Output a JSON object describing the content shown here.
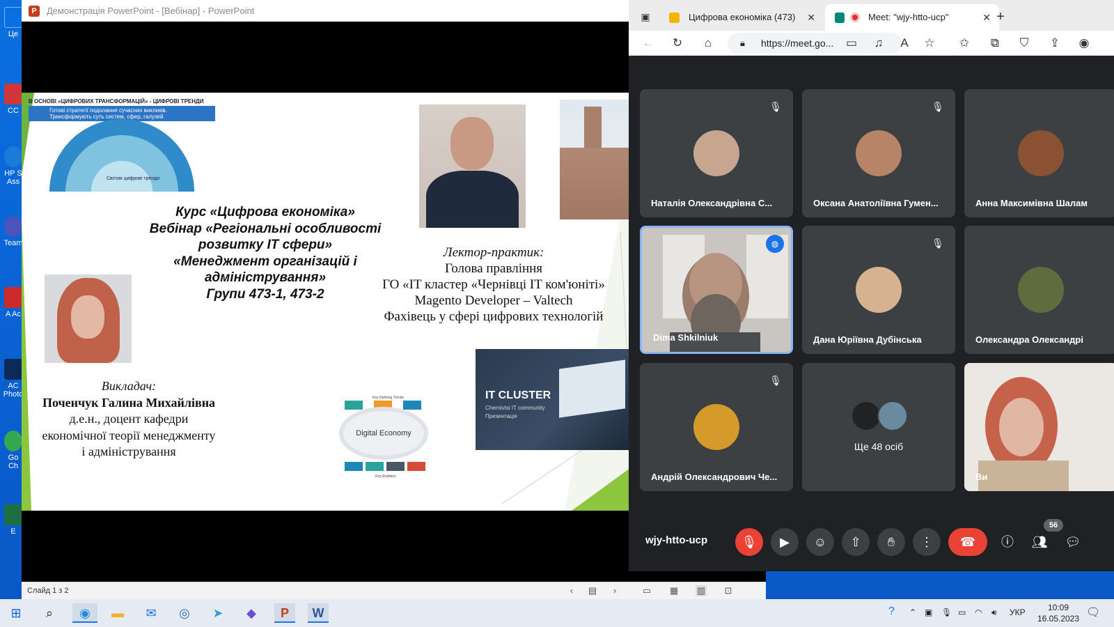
{
  "desktop": {
    "icons": [
      {
        "label": "Це",
        "color": "#0a6fe0"
      },
      {
        "label": "CC",
        "color": "#d0363b"
      },
      {
        "label": "HP S Ass",
        "color": "#1c7bd8"
      },
      {
        "label": "Team",
        "color": "#4b53bc"
      },
      {
        "label": "A Ac",
        "color": "#cc2b2b"
      },
      {
        "label": "AC Photo",
        "color": "#0b2a58"
      },
      {
        "label": "Go Ch",
        "color": "#34a853"
      },
      {
        "label": "E",
        "color": "#1d6f42"
      }
    ]
  },
  "ppt": {
    "title": "Демонстрація PowerPoint - [Вебінар] - PowerPoint",
    "status_slide": "Слайд 1 з 2"
  },
  "slide": {
    "infographic_head": "В ОСНОВІ «ЦИФРОВИХ ТРАНСФОРМАЦІЙ» - ЦИФРОВІ ТРЕНДИ",
    "infographic_band": "Готові стратегії подолання сучасних викликів. Трансформують суть систем, сфер, галузей.",
    "infographic_center": "Світові цифрові тренди",
    "course_lines": [
      "Курс «Цифрова економіка»",
      "Вебінар «Регіональні особливості",
      "розвитку IT сфери»",
      "«Менеджмент організацій і",
      "адміністрування»",
      "Групи 473-1, 473-2"
    ],
    "lecturer_label": "Лектор-практик:",
    "lecturer_lines": [
      "Голова правління",
      "ГО «IT кластер «Чернівці IT ком'юніті»",
      "Magento Developer – Valtech",
      "Фахівець у сфері цифрових технологій"
    ],
    "teacher_label": "Викладач:",
    "teacher_name": "Поченчук Галина Михайлівна",
    "teacher_lines": [
      "д.е.н., доцент кафедри",
      "економічної теорії менеджменту",
      "і адміністрування"
    ],
    "de_center": "Digital Economy",
    "de_top": "Key Defining Trends",
    "de_bottom": "Key Enablers",
    "cluster_title": "IT CLUSTER",
    "cluster_sub": "Chernivtsi IT community",
    "cluster_sub2": "Презентація"
  },
  "meet": {
    "tabs": [
      {
        "label": "Цифрова економіка (473)",
        "close": "✕"
      },
      {
        "label": "Meet: \"wjy-htto-ucp\"",
        "close": "✕"
      }
    ],
    "new_tab": "+",
    "url": "https://meet.go...",
    "participants": [
      {
        "name": "Наталія Олександрівна С...",
        "muted": true,
        "avatar_color": "#c8a58e"
      },
      {
        "name": "Оксана Анатоліївна Гумен...",
        "muted": true,
        "avatar_color": "#b78468"
      },
      {
        "name": "Анна Максимівна Шалам",
        "muted": false,
        "avatar_color": "#8a5232"
      },
      {
        "name": "Dima Shkilniuk",
        "muted": false,
        "avatar_color": "#6b6e70"
      },
      {
        "name": "Дана Юріївна Дубінська",
        "muted": true,
        "avatar_color": "#d7b290"
      },
      {
        "name": "Олександра Олександрі",
        "muted": false,
        "avatar_color": "#5d6d3e"
      },
      {
        "name": "Андрій Олександрович Че...",
        "muted": true,
        "avatar_color": "#d49a2a"
      },
      {
        "name": "Ще 48 осіб",
        "muted": false,
        "avatar_color": "#222"
      },
      {
        "name": "Ви",
        "muted": false,
        "avatar_color": "#c6614a"
      }
    ],
    "meeting_code": "wjy-htto-ucp",
    "people_count": "56"
  },
  "taskbar": {
    "language": "УКР",
    "time": "10:09",
    "date": "16.05.2023"
  },
  "colors": {
    "meet_bg": "#202124",
    "tile_bg": "#3c4043",
    "end_call": "#ea4335",
    "active_border": "#8ab4f8",
    "slide_green": "#8cc63f"
  }
}
